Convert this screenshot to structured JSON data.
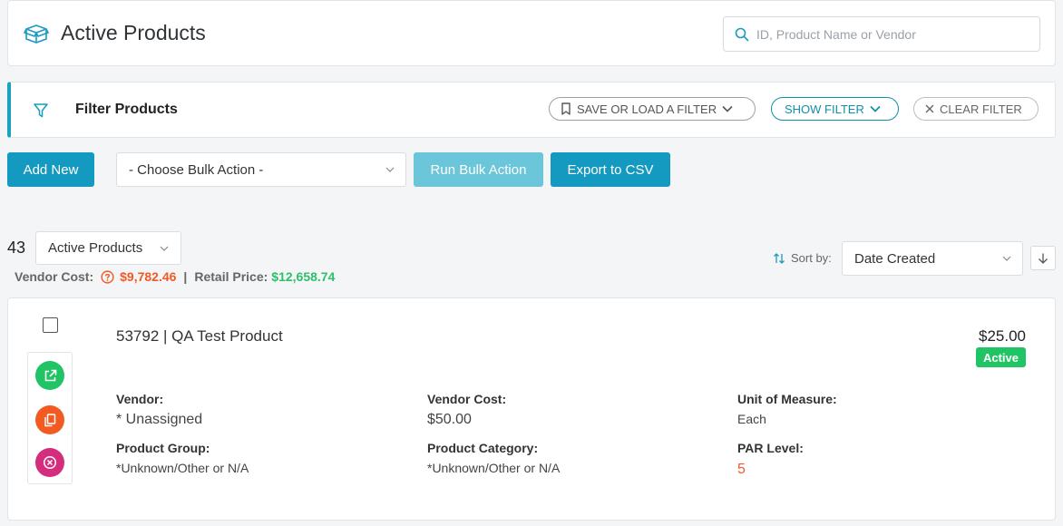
{
  "header": {
    "title": "Active Products",
    "search_placeholder": "ID, Product Name or Vendor"
  },
  "filter": {
    "title": "Filter Products",
    "save_load_label": "SAVE OR LOAD A FILTER",
    "show_label": "SHOW FILTER",
    "clear_label": "CLEAR FILTER"
  },
  "toolbar": {
    "add_new_label": "Add New",
    "bulk_action_selected": "- Choose Bulk Action -",
    "run_bulk_label": "Run Bulk Action",
    "export_label": "Export to CSV"
  },
  "summary": {
    "count": "43",
    "status_selected": "Active Products",
    "vendor_cost_label": "Vendor Cost:",
    "vendor_cost_value": "$9,782.46",
    "separator": "|",
    "retail_price_label": "Retail Price:",
    "retail_price_value": "$12,658.74",
    "sort_label": "Sort by:",
    "sort_selected": "Date Created"
  },
  "product": {
    "title": "53792 | QA Test Product",
    "price": "$25.00",
    "status": "Active",
    "fields": {
      "vendor_label": "Vendor:",
      "vendor_value": "* Unassigned",
      "vendor_cost_label": "Vendor Cost:",
      "vendor_cost_value": "$50.00",
      "uom_label": "Unit of Measure:",
      "uom_value": "Each",
      "group_label": "Product Group:",
      "group_value": "*Unknown/Other or N/A",
      "category_label": "Product Category:",
      "category_value": "*Unknown/Other or N/A",
      "par_label": "PAR Level:",
      "par_value": "5"
    }
  },
  "colors": {
    "accent": "#149ac0",
    "accent_light": "#6ac6d8",
    "success": "#21c465",
    "warning": "#f15a24",
    "danger": "#d42d7d",
    "retail": "#2ebf6a"
  },
  "icons": [
    "box-icon",
    "search-icon",
    "funnel-icon",
    "bookmark-icon",
    "chevron-down-icon",
    "close-icon",
    "help-circle-icon",
    "sort-icon",
    "arrow-down-icon",
    "open-external-icon",
    "copy-icon",
    "delete-icon"
  ]
}
